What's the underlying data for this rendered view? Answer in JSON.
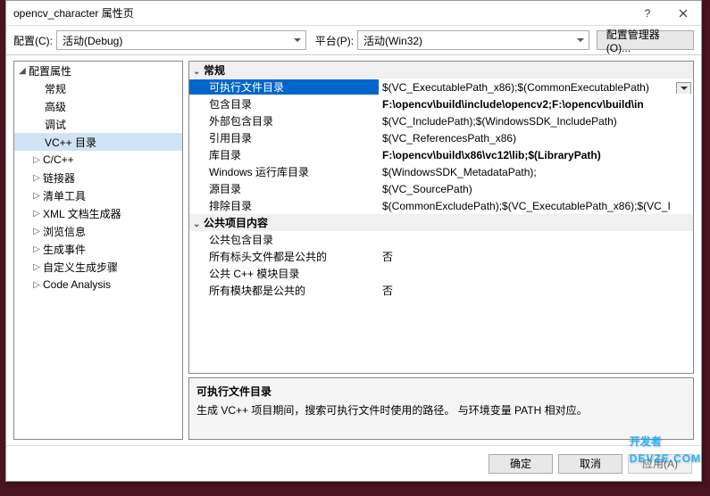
{
  "title": "opencv_character 属性页",
  "config_label": "配置(C):",
  "config_value": "活动(Debug)",
  "platform_label": "平台(P):",
  "platform_value": "活动(Win32)",
  "config_mgr_btn": "配置管理器(O)...",
  "tree": {
    "root": "配置属性",
    "items": [
      {
        "label": "常规",
        "exp": false
      },
      {
        "label": "高级",
        "exp": false
      },
      {
        "label": "调试",
        "exp": false
      },
      {
        "label": "VC++ 目录",
        "exp": false,
        "selected": true
      },
      {
        "label": "C/C++",
        "exp": true
      },
      {
        "label": "链接器",
        "exp": true
      },
      {
        "label": "清单工具",
        "exp": true
      },
      {
        "label": "XML 文档生成器",
        "exp": true
      },
      {
        "label": "浏览信息",
        "exp": true
      },
      {
        "label": "生成事件",
        "exp": true
      },
      {
        "label": "自定义生成步骤",
        "exp": true
      },
      {
        "label": "Code Analysis",
        "exp": true
      }
    ]
  },
  "groups": [
    {
      "label": "常规",
      "rows": [
        {
          "label": "可执行文件目录",
          "value": "$(VC_ExecutablePath_x86);$(CommonExecutablePath)",
          "sel": true
        },
        {
          "label": "包含目录",
          "value": "F:\\opencv\\build\\include\\opencv2;F:\\opencv\\build\\in",
          "bold": true
        },
        {
          "label": "外部包含目录",
          "value": "$(VC_IncludePath);$(WindowsSDK_IncludePath)"
        },
        {
          "label": "引用目录",
          "value": "$(VC_ReferencesPath_x86)"
        },
        {
          "label": "库目录",
          "value": "F:\\opencv\\build\\x86\\vc12\\lib;$(LibraryPath)",
          "bold": true
        },
        {
          "label": "Windows 运行库目录",
          "value": "$(WindowsSDK_MetadataPath);"
        },
        {
          "label": "源目录",
          "value": "$(VC_SourcePath)"
        },
        {
          "label": "排除目录",
          "value": "$(CommonExcludePath);$(VC_ExecutablePath_x86);$(VC_I"
        }
      ]
    },
    {
      "label": "公共项目内容",
      "rows": [
        {
          "label": "公共包含目录",
          "value": ""
        },
        {
          "label": "所有标头文件都是公共的",
          "value": "否"
        },
        {
          "label": "公共 C++ 模块目录",
          "value": ""
        },
        {
          "label": "所有模块都是公共的",
          "value": "否"
        }
      ]
    }
  ],
  "desc": {
    "title": "可执行文件目录",
    "body": "生成 VC++ 项目期间，搜索可执行文件时使用的路径。   与环境变量 PATH 相对应。"
  },
  "footer": {
    "ok": "确定",
    "cancel": "取消",
    "apply": "应用(A)"
  },
  "watermark": "开发者",
  "watermark_sub": "DEVZE.COM"
}
